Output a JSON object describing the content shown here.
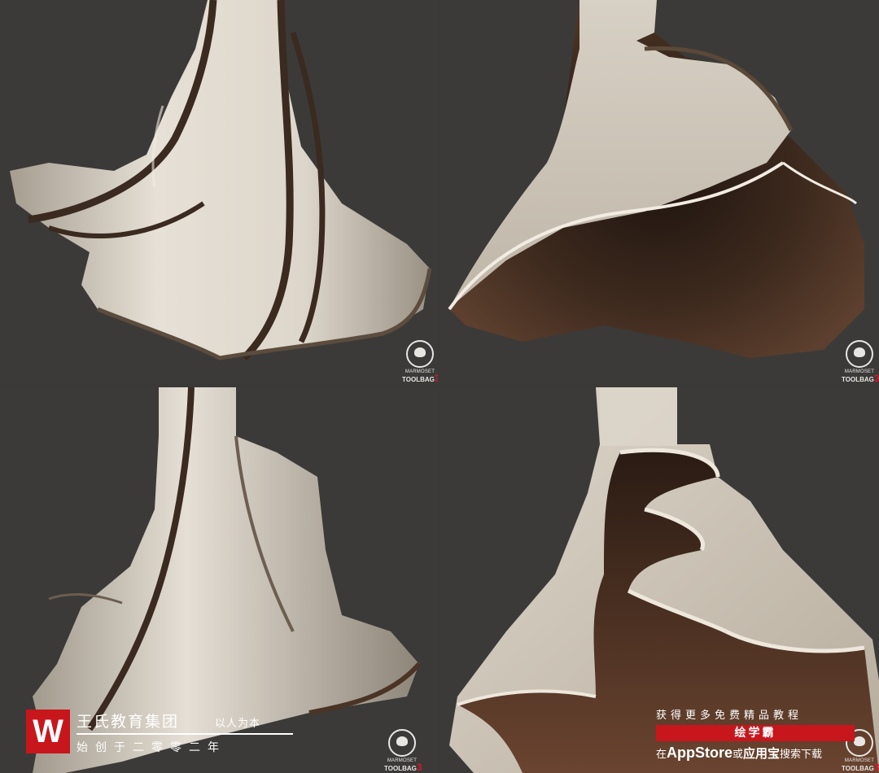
{
  "watermark": {
    "line1": "MARMOSET",
    "line2": "TOOLBAG",
    "version": "3"
  },
  "brand": {
    "logo_letter": "W",
    "name": "王氏教育集团",
    "motto": "以人为本",
    "since": "始创于二零零二年"
  },
  "promo": {
    "line1": "获得更多免费精品教程",
    "app_name": "绘学霸",
    "prefix": "在",
    "store1": "AppStore",
    "or": "或",
    "store2": "应用宝",
    "suffix": "搜索下载"
  },
  "colors": {
    "background": "#3b3a38",
    "fabric_light": "#e3ddd3",
    "fabric_shadow": "#8c8478",
    "lining_brown": "#4a3124",
    "brand_red": "#c8161d"
  }
}
